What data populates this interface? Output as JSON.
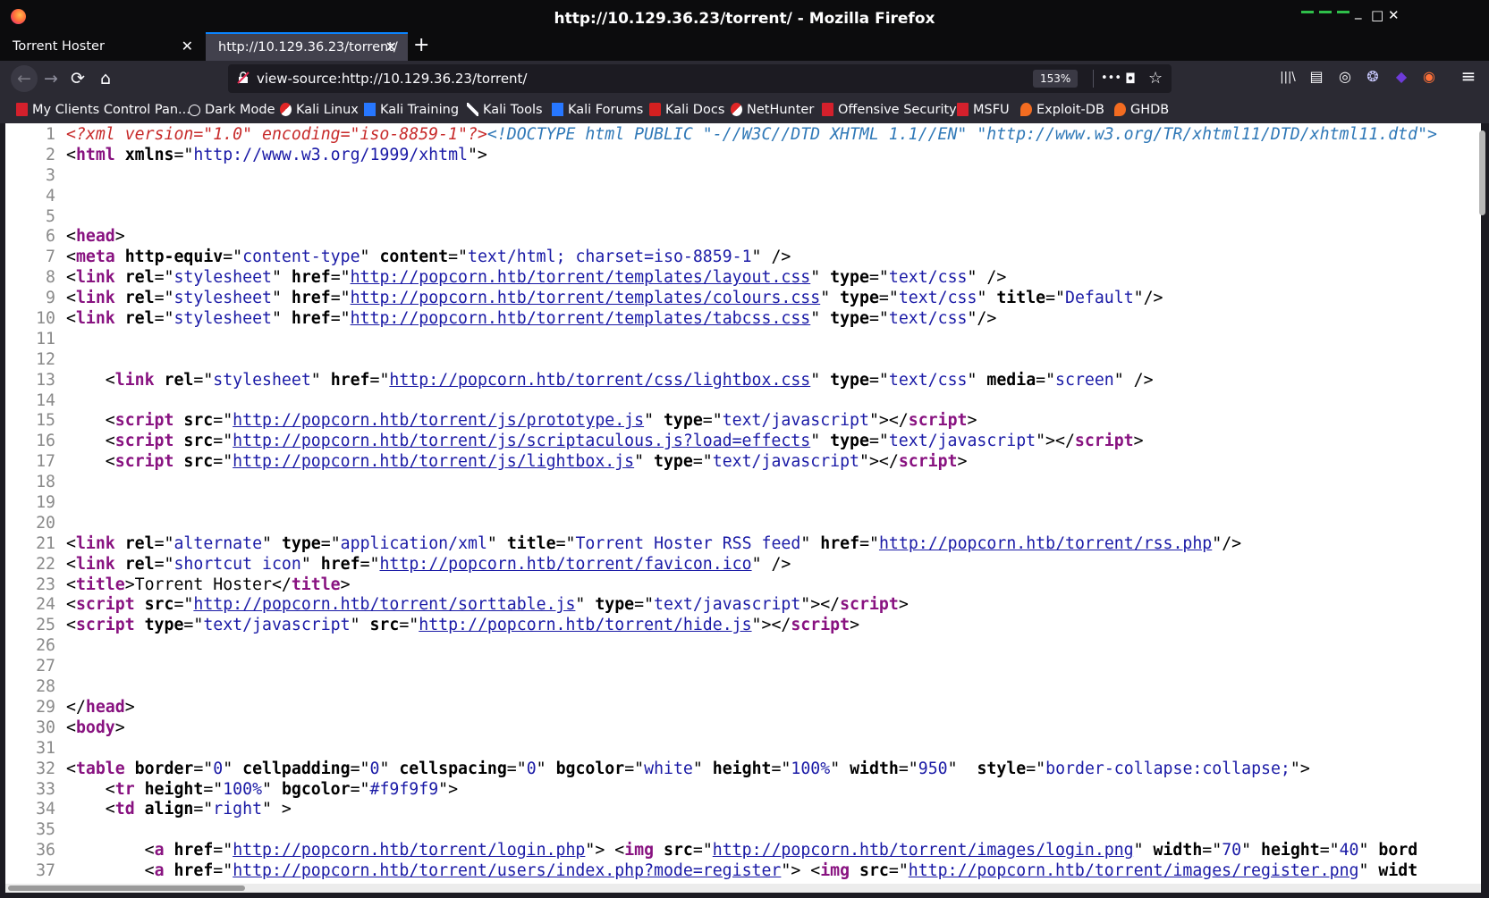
{
  "window": {
    "title": "http://10.129.36.23/torrent/ - Mozilla Firefox",
    "minimize": "_",
    "maximize": "□",
    "close": "✕"
  },
  "tabs": [
    {
      "label": "Torrent Hoster",
      "close": "✕",
      "active": false
    },
    {
      "label": "http://10.129.36.23/torrent/",
      "close": "✕",
      "active": true
    }
  ],
  "new_tab": "+",
  "nav": {
    "back": "←",
    "forward": "→",
    "reload": "⟳",
    "home": "⌂",
    "url": "view-source:http://10.129.36.23/torrent/",
    "zoom": "153%",
    "page_actions": "•••",
    "pocket": "◘",
    "bookmark_star": "☆",
    "library": "|||\\",
    "sidebar": "▤",
    "account": "◎",
    "ext1": "❂",
    "ext2": "◆",
    "ext3": "◉",
    "menu": "≡"
  },
  "bookmarks": [
    {
      "label": "My Clients Control Pan...",
      "icon": "kali-red"
    },
    {
      "label": "Dark Mode",
      "icon": "globe"
    },
    {
      "label": "Kali Linux",
      "icon": "kali-dragon"
    },
    {
      "label": "Kali Training",
      "icon": "kali-blue"
    },
    {
      "label": "Kali Tools",
      "icon": "tools"
    },
    {
      "label": "Kali Forums",
      "icon": "kali-blue"
    },
    {
      "label": "Kali Docs",
      "icon": "docs"
    },
    {
      "label": "NetHunter",
      "icon": "kali-dragon"
    },
    {
      "label": "Offensive Security",
      "icon": "kali-red"
    },
    {
      "label": "MSFU",
      "icon": "kali-red"
    },
    {
      "label": "Exploit-DB",
      "icon": "orange"
    },
    {
      "label": "GHDB",
      "icon": "orange"
    }
  ],
  "source_lines": [
    {
      "n": "1",
      "tokens": [
        [
          "pi",
          "<?xml version=\"1.0\" encoding=\"iso-8859-1\"?>"
        ],
        [
          "dt",
          "<!DOCTYPE html PUBLIC \"-//W3C//DTD XHTML 1.1//EN\" \"http://www.w3.org/TR/xhtml11/DTD/xhtml11.dtd\">"
        ]
      ]
    },
    {
      "n": "2",
      "tokens": [
        [
          "p",
          "<"
        ],
        [
          "tag",
          "html"
        ],
        [
          "p",
          " "
        ],
        [
          "attr",
          "xmlns"
        ],
        [
          "p",
          "=\""
        ],
        [
          "val",
          "http://www.w3.org/1999/xhtml"
        ],
        [
          "p",
          "\">"
        ]
      ]
    },
    {
      "n": "3",
      "tokens": []
    },
    {
      "n": "4",
      "tokens": []
    },
    {
      "n": "5",
      "tokens": []
    },
    {
      "n": "6",
      "tokens": [
        [
          "p",
          "<"
        ],
        [
          "tag",
          "head"
        ],
        [
          "p",
          ">"
        ]
      ]
    },
    {
      "n": "7",
      "tokens": [
        [
          "p",
          "<"
        ],
        [
          "tag",
          "meta"
        ],
        [
          "p",
          " "
        ],
        [
          "attr",
          "http-equiv"
        ],
        [
          "p",
          "=\""
        ],
        [
          "val",
          "content-type"
        ],
        [
          "p",
          "\" "
        ],
        [
          "attr",
          "content"
        ],
        [
          "p",
          "=\""
        ],
        [
          "val",
          "text/html; charset=iso-8859-1"
        ],
        [
          "p",
          "\" />"
        ]
      ]
    },
    {
      "n": "8",
      "tokens": [
        [
          "p",
          "<"
        ],
        [
          "tag",
          "link"
        ],
        [
          "p",
          " "
        ],
        [
          "attr",
          "rel"
        ],
        [
          "p",
          "=\""
        ],
        [
          "val",
          "stylesheet"
        ],
        [
          "p",
          "\" "
        ],
        [
          "attr",
          "href"
        ],
        [
          "p",
          "=\""
        ],
        [
          "lnk",
          "http://popcorn.htb/torrent/templates/layout.css"
        ],
        [
          "p",
          "\" "
        ],
        [
          "attr",
          "type"
        ],
        [
          "p",
          "=\""
        ],
        [
          "val",
          "text/css"
        ],
        [
          "p",
          "\" />"
        ]
      ]
    },
    {
      "n": "9",
      "tokens": [
        [
          "p",
          "<"
        ],
        [
          "tag",
          "link"
        ],
        [
          "p",
          " "
        ],
        [
          "attr",
          "rel"
        ],
        [
          "p",
          "=\""
        ],
        [
          "val",
          "stylesheet"
        ],
        [
          "p",
          "\" "
        ],
        [
          "attr",
          "href"
        ],
        [
          "p",
          "=\""
        ],
        [
          "lnk",
          "http://popcorn.htb/torrent/templates/colours.css"
        ],
        [
          "p",
          "\" "
        ],
        [
          "attr",
          "type"
        ],
        [
          "p",
          "=\""
        ],
        [
          "val",
          "text/css"
        ],
        [
          "p",
          "\" "
        ],
        [
          "attr",
          "title"
        ],
        [
          "p",
          "=\""
        ],
        [
          "val",
          "Default"
        ],
        [
          "p",
          "\"/>"
        ]
      ]
    },
    {
      "n": "10",
      "tokens": [
        [
          "p",
          "<"
        ],
        [
          "tag",
          "link"
        ],
        [
          "p",
          " "
        ],
        [
          "attr",
          "rel"
        ],
        [
          "p",
          "=\""
        ],
        [
          "val",
          "stylesheet"
        ],
        [
          "p",
          "\" "
        ],
        [
          "attr",
          "href"
        ],
        [
          "p",
          "=\""
        ],
        [
          "lnk",
          "http://popcorn.htb/torrent/templates/tabcss.css"
        ],
        [
          "p",
          "\" "
        ],
        [
          "attr",
          "type"
        ],
        [
          "p",
          "=\""
        ],
        [
          "val",
          "text/css"
        ],
        [
          "p",
          "\"/>"
        ]
      ]
    },
    {
      "n": "11",
      "tokens": []
    },
    {
      "n": "12",
      "tokens": []
    },
    {
      "n": "13",
      "tokens": [
        [
          "p",
          "    <"
        ],
        [
          "tag",
          "link"
        ],
        [
          "p",
          " "
        ],
        [
          "attr",
          "rel"
        ],
        [
          "p",
          "=\""
        ],
        [
          "val",
          "stylesheet"
        ],
        [
          "p",
          "\" "
        ],
        [
          "attr",
          "href"
        ],
        [
          "p",
          "=\""
        ],
        [
          "lnk",
          "http://popcorn.htb/torrent/css/lightbox.css"
        ],
        [
          "p",
          "\" "
        ],
        [
          "attr",
          "type"
        ],
        [
          "p",
          "=\""
        ],
        [
          "val",
          "text/css"
        ],
        [
          "p",
          "\" "
        ],
        [
          "attr",
          "media"
        ],
        [
          "p",
          "=\""
        ],
        [
          "val",
          "screen"
        ],
        [
          "p",
          "\" />"
        ]
      ]
    },
    {
      "n": "14",
      "tokens": []
    },
    {
      "n": "15",
      "tokens": [
        [
          "p",
          "    <"
        ],
        [
          "tag",
          "script"
        ],
        [
          "p",
          " "
        ],
        [
          "attr",
          "src"
        ],
        [
          "p",
          "=\""
        ],
        [
          "lnk",
          "http://popcorn.htb/torrent/js/prototype.js"
        ],
        [
          "p",
          "\" "
        ],
        [
          "attr",
          "type"
        ],
        [
          "p",
          "=\""
        ],
        [
          "val",
          "text/javascript"
        ],
        [
          "p",
          "\"></"
        ],
        [
          "tag",
          "script"
        ],
        [
          "p",
          ">"
        ]
      ]
    },
    {
      "n": "16",
      "tokens": [
        [
          "p",
          "    <"
        ],
        [
          "tag",
          "script"
        ],
        [
          "p",
          " "
        ],
        [
          "attr",
          "src"
        ],
        [
          "p",
          "=\""
        ],
        [
          "lnk",
          "http://popcorn.htb/torrent/js/scriptaculous.js?load=effects"
        ],
        [
          "p",
          "\" "
        ],
        [
          "attr",
          "type"
        ],
        [
          "p",
          "=\""
        ],
        [
          "val",
          "text/javascript"
        ],
        [
          "p",
          "\"></"
        ],
        [
          "tag",
          "script"
        ],
        [
          "p",
          ">"
        ]
      ]
    },
    {
      "n": "17",
      "tokens": [
        [
          "p",
          "    <"
        ],
        [
          "tag",
          "script"
        ],
        [
          "p",
          " "
        ],
        [
          "attr",
          "src"
        ],
        [
          "p",
          "=\""
        ],
        [
          "lnk",
          "http://popcorn.htb/torrent/js/lightbox.js"
        ],
        [
          "p",
          "\" "
        ],
        [
          "attr",
          "type"
        ],
        [
          "p",
          "=\""
        ],
        [
          "val",
          "text/javascript"
        ],
        [
          "p",
          "\"></"
        ],
        [
          "tag",
          "script"
        ],
        [
          "p",
          ">"
        ]
      ]
    },
    {
      "n": "18",
      "tokens": []
    },
    {
      "n": "19",
      "tokens": []
    },
    {
      "n": "20",
      "tokens": []
    },
    {
      "n": "21",
      "tokens": [
        [
          "p",
          "<"
        ],
        [
          "tag",
          "link"
        ],
        [
          "p",
          " "
        ],
        [
          "attr",
          "rel"
        ],
        [
          "p",
          "=\""
        ],
        [
          "val",
          "alternate"
        ],
        [
          "p",
          "\" "
        ],
        [
          "attr",
          "type"
        ],
        [
          "p",
          "=\""
        ],
        [
          "val",
          "application/xml"
        ],
        [
          "p",
          "\" "
        ],
        [
          "attr",
          "title"
        ],
        [
          "p",
          "=\""
        ],
        [
          "val",
          "Torrent Hoster RSS feed"
        ],
        [
          "p",
          "\" "
        ],
        [
          "attr",
          "href"
        ],
        [
          "p",
          "=\""
        ],
        [
          "lnk",
          "http://popcorn.htb/torrent/rss.php"
        ],
        [
          "p",
          "\"/>"
        ]
      ]
    },
    {
      "n": "22",
      "tokens": [
        [
          "p",
          "<"
        ],
        [
          "tag",
          "link"
        ],
        [
          "p",
          " "
        ],
        [
          "attr",
          "rel"
        ],
        [
          "p",
          "=\""
        ],
        [
          "val",
          "shortcut icon"
        ],
        [
          "p",
          "\" "
        ],
        [
          "attr",
          "href"
        ],
        [
          "p",
          "=\""
        ],
        [
          "lnk",
          "http://popcorn.htb/torrent/favicon.ico"
        ],
        [
          "p",
          "\" />"
        ]
      ]
    },
    {
      "n": "23",
      "tokens": [
        [
          "p",
          "<"
        ],
        [
          "tag",
          "title"
        ],
        [
          "p",
          ">Torrent Hoster</"
        ],
        [
          "tag",
          "title"
        ],
        [
          "p",
          ">"
        ]
      ]
    },
    {
      "n": "24",
      "tokens": [
        [
          "p",
          "<"
        ],
        [
          "tag",
          "script"
        ],
        [
          "p",
          " "
        ],
        [
          "attr",
          "src"
        ],
        [
          "p",
          "=\""
        ],
        [
          "lnk",
          "http://popcorn.htb/torrent/sorttable.js"
        ],
        [
          "p",
          "\" "
        ],
        [
          "attr",
          "type"
        ],
        [
          "p",
          "=\""
        ],
        [
          "val",
          "text/javascript"
        ],
        [
          "p",
          "\"></"
        ],
        [
          "tag",
          "script"
        ],
        [
          "p",
          ">"
        ]
      ]
    },
    {
      "n": "25",
      "tokens": [
        [
          "p",
          "<"
        ],
        [
          "tag",
          "script"
        ],
        [
          "p",
          " "
        ],
        [
          "attr",
          "type"
        ],
        [
          "p",
          "=\""
        ],
        [
          "val",
          "text/javascript"
        ],
        [
          "p",
          "\" "
        ],
        [
          "attr",
          "src"
        ],
        [
          "p",
          "=\""
        ],
        [
          "lnk",
          "http://popcorn.htb/torrent/hide.js"
        ],
        [
          "p",
          "\"></"
        ],
        [
          "tag",
          "script"
        ],
        [
          "p",
          ">"
        ]
      ]
    },
    {
      "n": "26",
      "tokens": []
    },
    {
      "n": "27",
      "tokens": []
    },
    {
      "n": "28",
      "tokens": []
    },
    {
      "n": "29",
      "tokens": [
        [
          "p",
          "</"
        ],
        [
          "tag",
          "head"
        ],
        [
          "p",
          ">"
        ]
      ]
    },
    {
      "n": "30",
      "tokens": [
        [
          "p",
          "<"
        ],
        [
          "tag",
          "body"
        ],
        [
          "p",
          ">"
        ]
      ]
    },
    {
      "n": "31",
      "tokens": []
    },
    {
      "n": "32",
      "tokens": [
        [
          "p",
          "<"
        ],
        [
          "tag",
          "table"
        ],
        [
          "p",
          " "
        ],
        [
          "attr",
          "border"
        ],
        [
          "p",
          "=\""
        ],
        [
          "val",
          "0"
        ],
        [
          "p",
          "\" "
        ],
        [
          "attr",
          "cellpadding"
        ],
        [
          "p",
          "=\""
        ],
        [
          "val",
          "0"
        ],
        [
          "p",
          "\" "
        ],
        [
          "attr",
          "cellspacing"
        ],
        [
          "p",
          "=\""
        ],
        [
          "val",
          "0"
        ],
        [
          "p",
          "\" "
        ],
        [
          "attr",
          "bgcolor"
        ],
        [
          "p",
          "=\""
        ],
        [
          "val",
          "white"
        ],
        [
          "p",
          "\" "
        ],
        [
          "attr",
          "height"
        ],
        [
          "p",
          "=\""
        ],
        [
          "val",
          "100%"
        ],
        [
          "p",
          "\" "
        ],
        [
          "attr",
          "width"
        ],
        [
          "p",
          "=\""
        ],
        [
          "val",
          "950"
        ],
        [
          "p",
          "\"  "
        ],
        [
          "attr",
          "style"
        ],
        [
          "p",
          "=\""
        ],
        [
          "val",
          "border-collapse:collapse;"
        ],
        [
          "p",
          "\">"
        ]
      ]
    },
    {
      "n": "33",
      "tokens": [
        [
          "p",
          "    <"
        ],
        [
          "tag",
          "tr"
        ],
        [
          "p",
          " "
        ],
        [
          "attr",
          "height"
        ],
        [
          "p",
          "=\""
        ],
        [
          "val",
          "100%"
        ],
        [
          "p",
          "\" "
        ],
        [
          "attr",
          "bgcolor"
        ],
        [
          "p",
          "=\""
        ],
        [
          "val",
          "#f9f9f9"
        ],
        [
          "p",
          "\">"
        ]
      ]
    },
    {
      "n": "34",
      "tokens": [
        [
          "p",
          "    <"
        ],
        [
          "tag",
          "td"
        ],
        [
          "p",
          " "
        ],
        [
          "attr",
          "align"
        ],
        [
          "p",
          "=\""
        ],
        [
          "val",
          "right"
        ],
        [
          "p",
          "\" >"
        ]
      ]
    },
    {
      "n": "35",
      "tokens": []
    },
    {
      "n": "36",
      "tokens": [
        [
          "p",
          "        <"
        ],
        [
          "tag",
          "a"
        ],
        [
          "p",
          " "
        ],
        [
          "attr",
          "href"
        ],
        [
          "p",
          "=\""
        ],
        [
          "lnk",
          "http://popcorn.htb/torrent/login.php"
        ],
        [
          "p",
          "\"> <"
        ],
        [
          "tag",
          "img"
        ],
        [
          "p",
          " "
        ],
        [
          "attr",
          "src"
        ],
        [
          "p",
          "=\""
        ],
        [
          "lnk",
          "http://popcorn.htb/torrent/images/login.png"
        ],
        [
          "p",
          "\" "
        ],
        [
          "attr",
          "width"
        ],
        [
          "p",
          "=\""
        ],
        [
          "val",
          "70"
        ],
        [
          "p",
          "\" "
        ],
        [
          "attr",
          "height"
        ],
        [
          "p",
          "=\""
        ],
        [
          "val",
          "40"
        ],
        [
          "p",
          "\" "
        ],
        [
          "attr",
          "bord"
        ]
      ]
    },
    {
      "n": "37",
      "tokens": [
        [
          "p",
          "        <"
        ],
        [
          "tag",
          "a"
        ],
        [
          "p",
          " "
        ],
        [
          "attr",
          "href"
        ],
        [
          "p",
          "=\""
        ],
        [
          "lnk",
          "http://popcorn.htb/torrent/users/index.php?mode=register"
        ],
        [
          "p",
          "\"> <"
        ],
        [
          "tag",
          "img"
        ],
        [
          "p",
          " "
        ],
        [
          "attr",
          "src"
        ],
        [
          "p",
          "=\""
        ],
        [
          "lnk",
          "http://popcorn.htb/torrent/images/register.png"
        ],
        [
          "p",
          "\" "
        ],
        [
          "attr",
          "widt"
        ]
      ]
    }
  ]
}
